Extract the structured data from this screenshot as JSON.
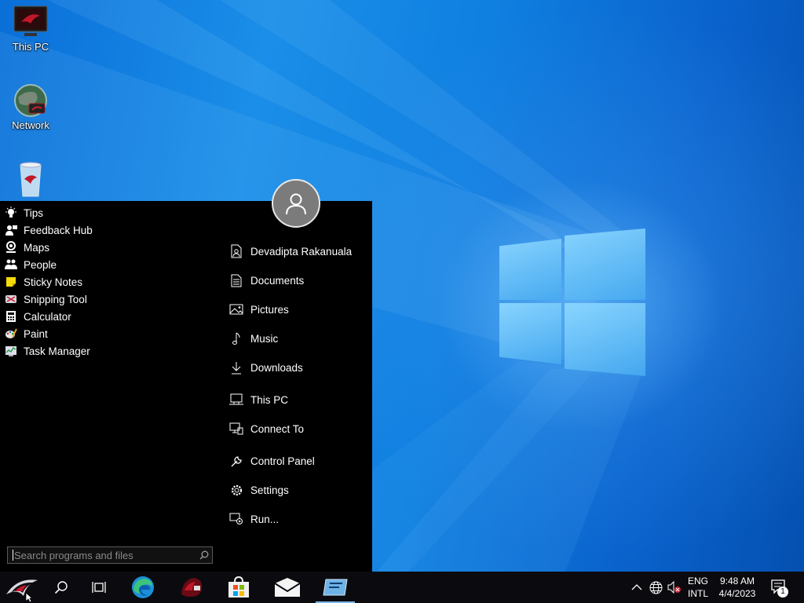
{
  "desktop": {
    "icons": [
      {
        "label": "This PC",
        "icon": "rog-monitor-icon"
      },
      {
        "label": "Network",
        "icon": "network-globe-icon"
      },
      {
        "label": "",
        "icon": "recycle-bin-icon"
      }
    ]
  },
  "start_menu": {
    "apps": [
      {
        "label": "Tips",
        "icon": "lightbulb-icon"
      },
      {
        "label": "Feedback Hub",
        "icon": "feedback-hub-icon"
      },
      {
        "label": "Maps",
        "icon": "maps-pin-icon"
      },
      {
        "label": "People",
        "icon": "people-icon"
      },
      {
        "label": "Sticky Notes",
        "icon": "sticky-notes-icon"
      },
      {
        "label": "Snipping Tool",
        "icon": "scissors-icon"
      },
      {
        "label": "Calculator",
        "icon": "calculator-icon"
      },
      {
        "label": "Paint",
        "icon": "paint-palette-icon"
      },
      {
        "label": "Task Manager",
        "icon": "task-manager-icon"
      }
    ],
    "places": [
      {
        "label": "Devadipta Rakanuala",
        "icon": "user-folder-icon"
      },
      {
        "label": "Documents",
        "icon": "document-icon"
      },
      {
        "label": "Pictures",
        "icon": "picture-icon"
      },
      {
        "label": "Music",
        "icon": "music-note-icon"
      },
      {
        "label": "Downloads",
        "icon": "download-arrow-icon"
      },
      {
        "label": "This PC",
        "icon": "computer-icon"
      },
      {
        "label": "Connect To",
        "icon": "connect-to-icon"
      },
      {
        "label": "Control Panel",
        "icon": "wrench-icon"
      },
      {
        "label": "Settings",
        "icon": "gear-icon"
      },
      {
        "label": "Run...",
        "icon": "run-icon"
      }
    ],
    "search": {
      "placeholder": "Search programs and files"
    }
  },
  "taskbar": {
    "apps": [
      "start-rog-logo-icon",
      "search-icon",
      "task-view-icon",
      "edge-icon",
      "rog-armoury-icon",
      "store-icon",
      "mail-icon",
      "open-shell-icon"
    ],
    "tray": {
      "language_line1": "ENG",
      "language_line2": "INTL",
      "time": "9:48 AM",
      "date": "4/4/2023",
      "notification_count": "1"
    }
  },
  "colors": {
    "accent": "#0a78d8",
    "menu_bg": "#000000",
    "taskbar_bg": "#0b0b0f"
  }
}
